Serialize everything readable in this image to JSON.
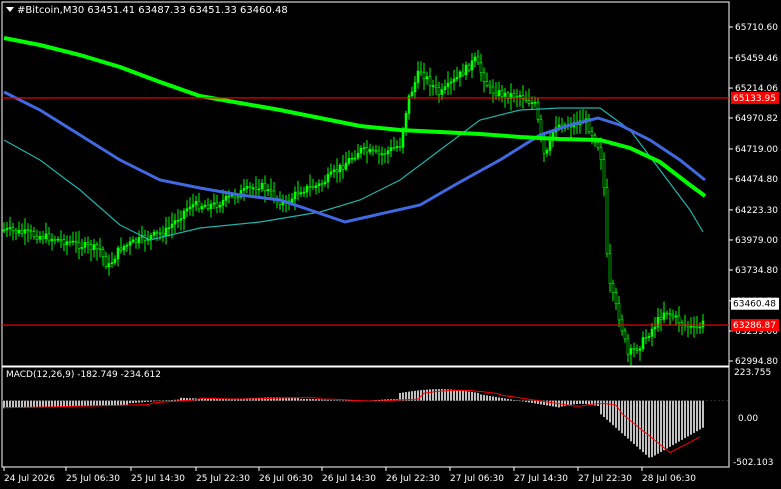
{
  "header": {
    "symbol_line": "#Bitcoin,M30  63451.41 63487.33 63451.33 63460.48",
    "menu_icon": "triangle-down-icon"
  },
  "price_axis": {
    "ticks": [
      "65710.60",
      "65459.46",
      "65214.06",
      "64970.82",
      "64719.00",
      "64474.80",
      "64223.30",
      "63979.00",
      "63734.80",
      "63483.50",
      "63239.00",
      "62994.80"
    ],
    "current_price_label": "63460.48",
    "level_upper_label": "65133.95",
    "level_lower_label": "63286.87"
  },
  "levels": {
    "upper": 65133.95,
    "lower": 63286.87,
    "color": "#ff0000"
  },
  "price_range": {
    "min": 62994.8,
    "max": 65710.6
  },
  "time_axis": {
    "labels": [
      "24 Jul 2026",
      "25 Jul 06:30",
      "25 Jul 14:30",
      "25 Jul 22:30",
      "26 Jul 06:30",
      "26 Jul 14:30",
      "26 Jul 22:30",
      "27 Jul 06:30",
      "27 Jul 14:30",
      "27 Jul 22:30",
      "28 Jul 06:30"
    ]
  },
  "macd": {
    "title": "MACD(12,26,9) -182.749 -234.612",
    "scale_top": "223.755",
    "scale_zero": "0.00",
    "scale_bottom": "-502.103",
    "range": {
      "min": -502.103,
      "max": 223.755
    },
    "histogram_color": "#c0c0c0",
    "signal_color": "#ff0000"
  },
  "colors": {
    "background": "#000000",
    "candle_up": "#00ff00",
    "ma_slow": "#00ff00",
    "ma_mid": "#4169e1",
    "ma_fast": "#20b2aa",
    "text": "#ffffff"
  }
}
